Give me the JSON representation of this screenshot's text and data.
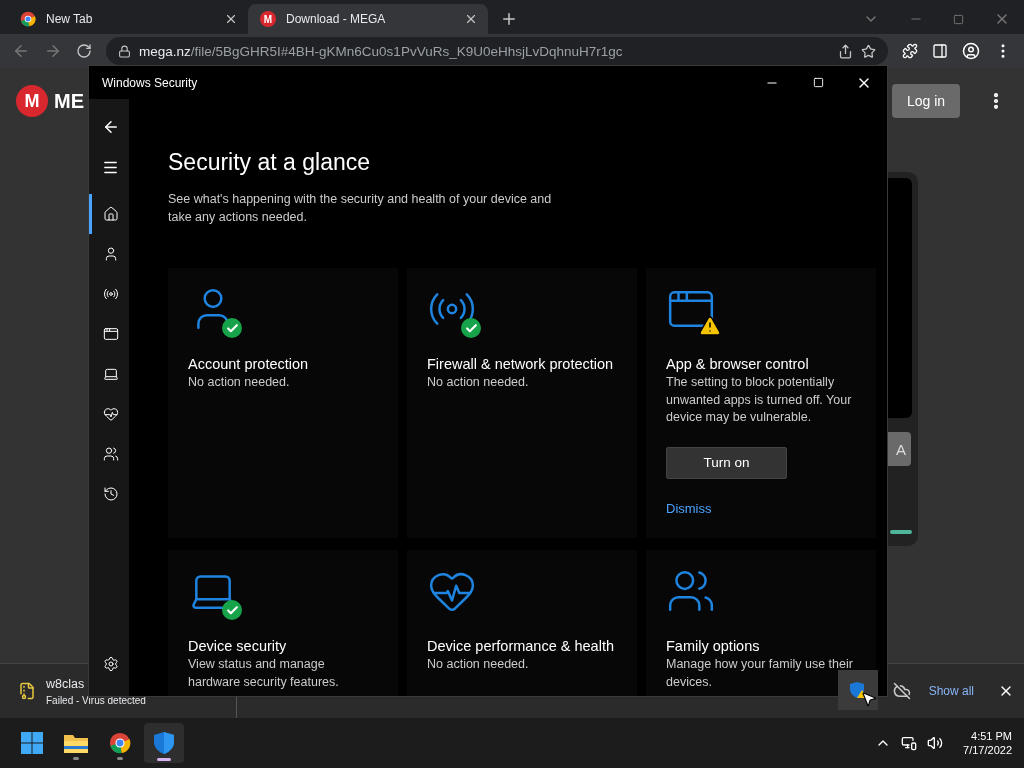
{
  "browser": {
    "tabs": [
      {
        "title": "New Tab",
        "selected": false
      },
      {
        "title": "Download - MEGA",
        "icon_letter": "M",
        "selected": true
      }
    ],
    "url": {
      "domain": "mega.nz",
      "path": "/file/5BgGHR5I#4BH-gKMn6Cu0s1PvVuRs_K9U0eHhsjLvDqhnuH7r1gc"
    }
  },
  "page": {
    "logo_mark": "M",
    "logo_text": "ME",
    "login": "Log in",
    "side_button": "A"
  },
  "security_window": {
    "title": "Windows Security",
    "nav": [
      {
        "selected": true
      },
      {
        "selected": false
      },
      {
        "selected": false
      },
      {
        "selected": false
      },
      {
        "selected": false
      },
      {
        "selected": false
      },
      {
        "selected": false
      },
      {
        "selected": false
      }
    ],
    "heading": "Security at a glance",
    "subtitle": "See what's happening with the security and health of your device and take any actions needed.",
    "cards": [
      {
        "kind": "ok",
        "title": "Account protection",
        "description": "No action needed."
      },
      {
        "kind": "ok",
        "title": "Firewall & network protection",
        "description": "No action needed."
      },
      {
        "kind": "warning",
        "title": "App & browser control",
        "description": "The setting to block potentially unwanted apps is turned off. Your device may be vulnerable.",
        "action": "Turn on",
        "link": "Dismiss"
      },
      {
        "kind": "ok",
        "title": "Device security",
        "description": "View status and manage hardware security features."
      },
      {
        "kind": "none",
        "title": "Device performance & health",
        "description": "No action needed."
      },
      {
        "kind": "none",
        "title": "Family options",
        "description": "Manage how your family use their devices."
      }
    ]
  },
  "download_bar": {
    "file": "w8clas",
    "status": "Failed - Virus detected",
    "show_all": "Show all"
  },
  "taskbar": {
    "apps": [
      {
        "running": false,
        "selected": false
      },
      {
        "running": true,
        "selected": false
      },
      {
        "running": true,
        "selected": false
      },
      {
        "running": true,
        "selected": true
      }
    ],
    "time": "4:51 PM",
    "date": "7/17/2022"
  }
}
